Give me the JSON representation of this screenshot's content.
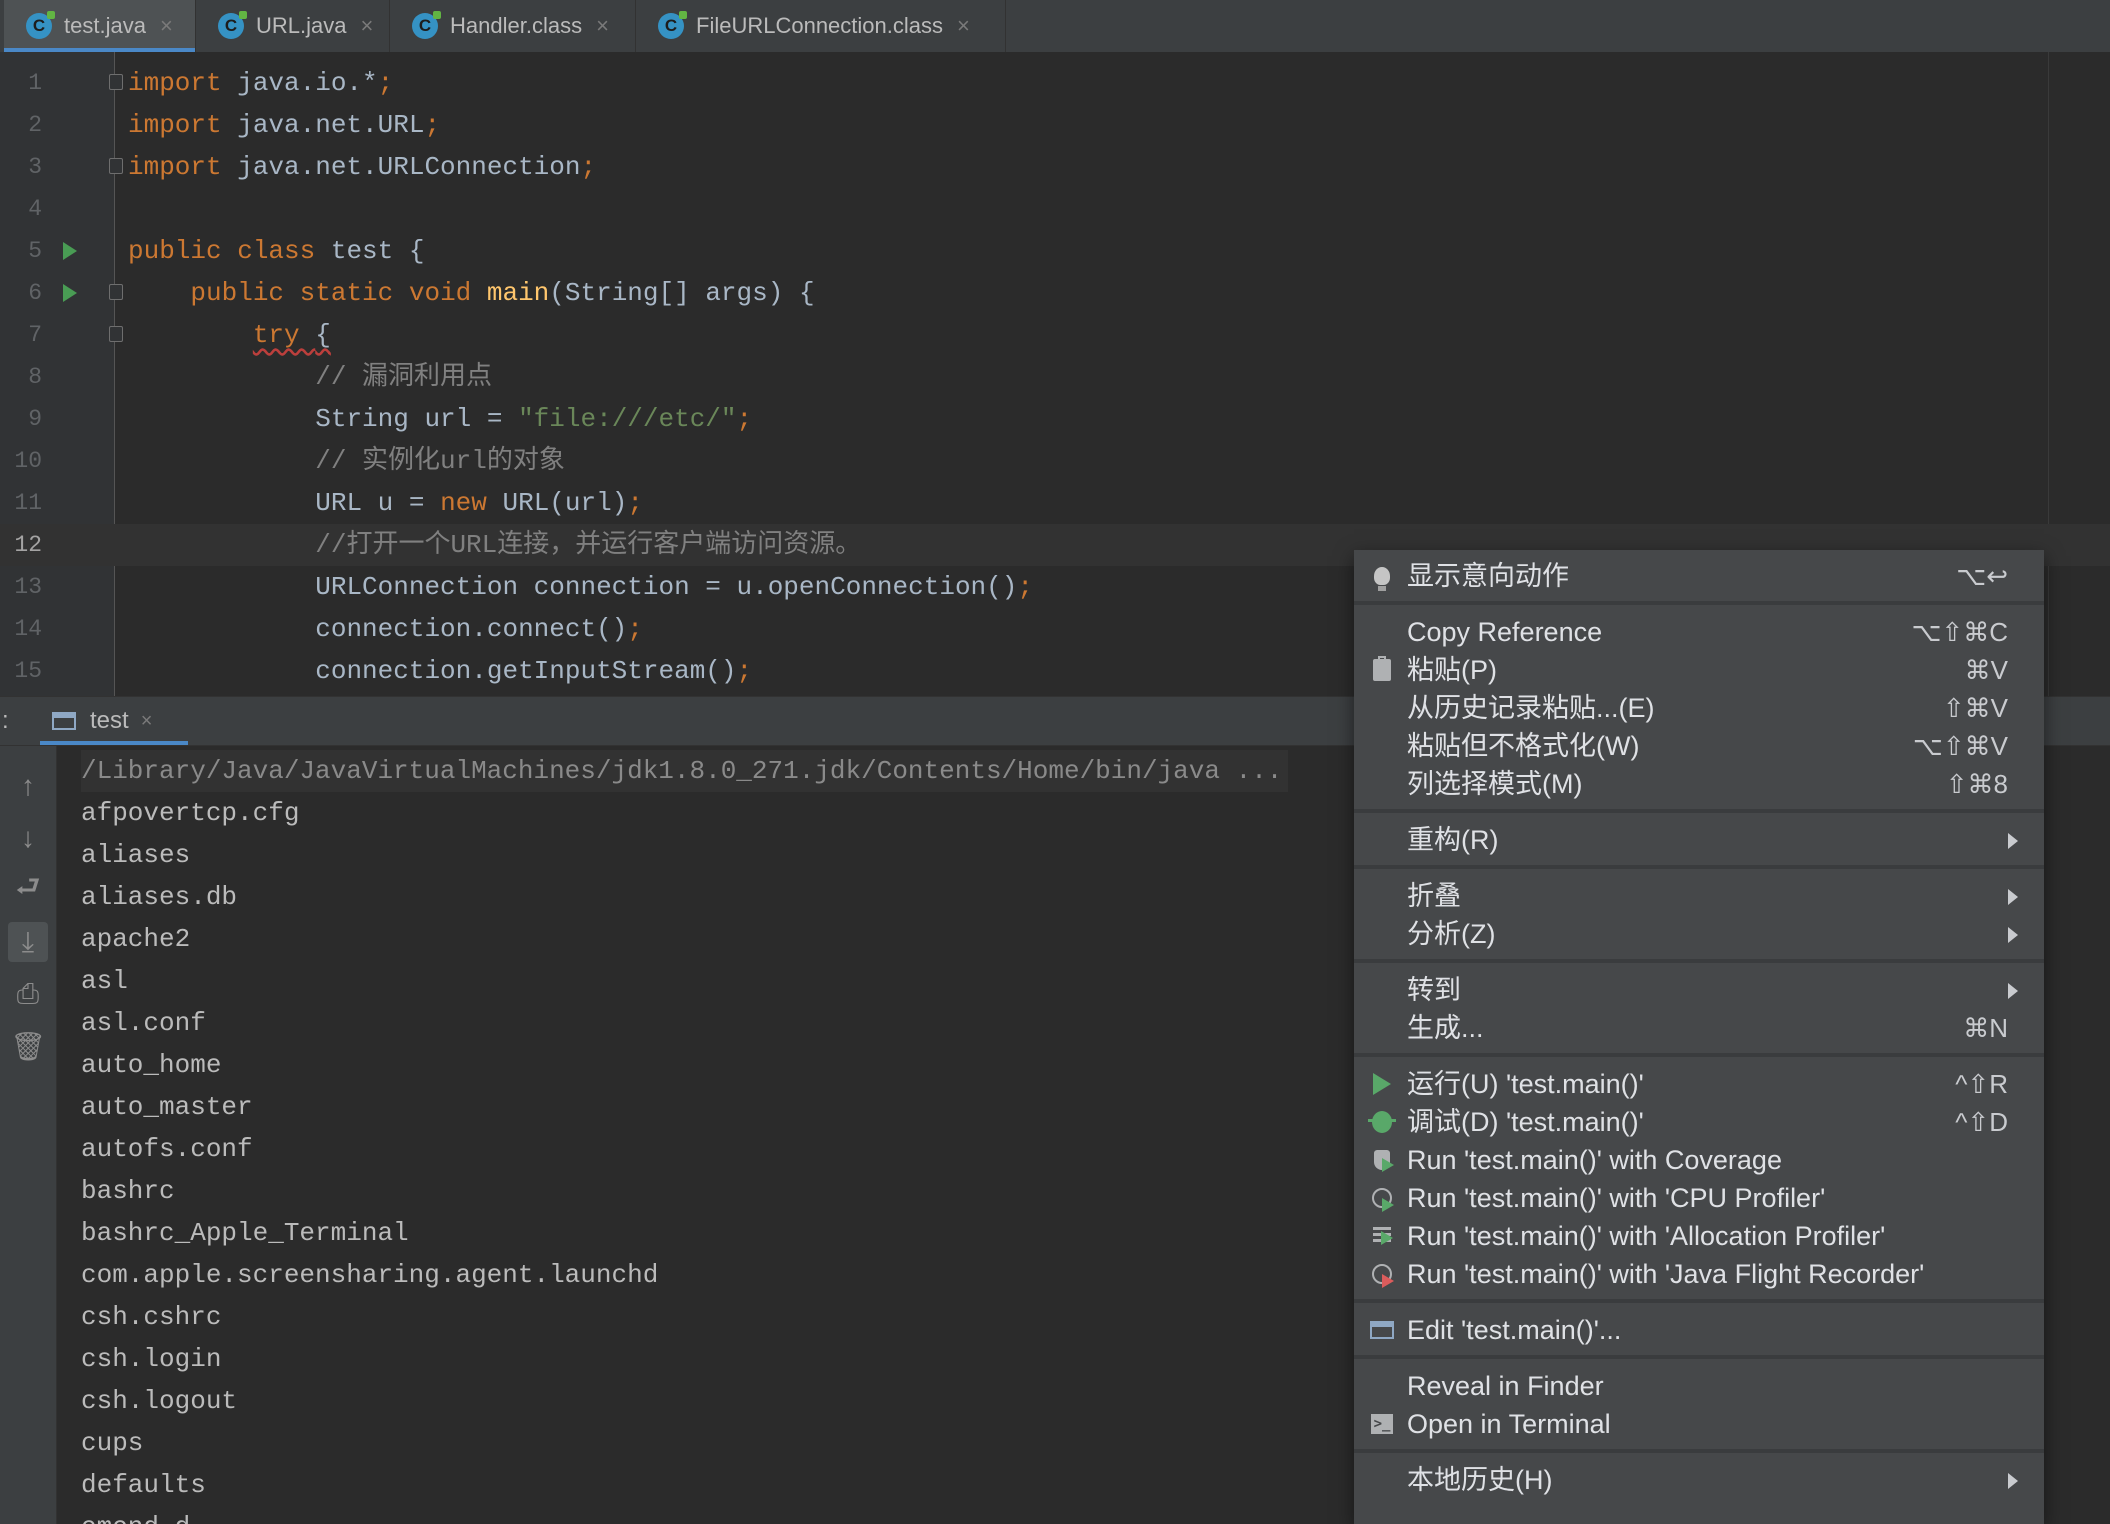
{
  "tabs": [
    {
      "label": "test.java",
      "icon": "java-class-icon",
      "active": true
    },
    {
      "label": "URL.java",
      "icon": "java-class-icon",
      "active": false
    },
    {
      "label": "Handler.class",
      "icon": "java-class-icon",
      "active": false
    },
    {
      "label": "FileURLConnection.class",
      "icon": "java-class-icon",
      "active": false
    }
  ],
  "editor": {
    "current_line": 12,
    "lines": [
      {
        "n": "1",
        "tokens": [
          [
            "kw",
            "import "
          ],
          [
            "",
            "java.io.*"
          ],
          [
            "kw",
            ";"
          ]
        ]
      },
      {
        "n": "2",
        "tokens": [
          [
            "kw",
            "import "
          ],
          [
            "",
            "java.net.URL"
          ],
          [
            "kw",
            ";"
          ]
        ]
      },
      {
        "n": "3",
        "tokens": [
          [
            "kw",
            "import "
          ],
          [
            "",
            "java.net.URLConnection"
          ],
          [
            "kw",
            ";"
          ]
        ]
      },
      {
        "n": "4",
        "tokens": []
      },
      {
        "n": "5",
        "tokens": [
          [
            "kw",
            "public class "
          ],
          [
            "",
            "test {"
          ]
        ]
      },
      {
        "n": "6",
        "tokens": [
          [
            "",
            "    "
          ],
          [
            "kw",
            "public static void "
          ],
          [
            "fn",
            "main"
          ],
          [
            "",
            "(String[] args) {"
          ]
        ]
      },
      {
        "n": "7",
        "tokens": [
          [
            "",
            "        "
          ],
          [
            "kw wavy",
            "try "
          ],
          [
            "wavy",
            "{"
          ]
        ]
      },
      {
        "n": "8",
        "tokens": [
          [
            "",
            "            "
          ],
          [
            "cmt",
            "// 漏洞利用点"
          ]
        ]
      },
      {
        "n": "9",
        "tokens": [
          [
            "",
            "            "
          ],
          [
            "",
            "String url = "
          ],
          [
            "str",
            "\"file:///etc/\""
          ],
          [
            "kw",
            ";"
          ]
        ]
      },
      {
        "n": "10",
        "tokens": [
          [
            "",
            "            "
          ],
          [
            "cmt",
            "// 实例化url的对象"
          ]
        ]
      },
      {
        "n": "11",
        "tokens": [
          [
            "",
            "            "
          ],
          [
            "",
            "URL u = "
          ],
          [
            "kw",
            "new "
          ],
          [
            "",
            "URL(url)"
          ],
          [
            "kw",
            ";"
          ]
        ]
      },
      {
        "n": "12",
        "tokens": [
          [
            "",
            "            "
          ],
          [
            "cmt",
            "//打开一个URL连接，并运行客户端访问资源。"
          ]
        ]
      },
      {
        "n": "13",
        "tokens": [
          [
            "",
            "            "
          ],
          [
            "",
            "URLConnection connection = u.openConnection()"
          ],
          [
            "kw",
            ";"
          ]
        ]
      },
      {
        "n": "14",
        "tokens": [
          [
            "",
            "            "
          ],
          [
            "",
            "connection.connect()"
          ],
          [
            "kw",
            ";"
          ]
        ]
      },
      {
        "n": "15",
        "tokens": [
          [
            "",
            "            "
          ],
          [
            "",
            "connection.getInputStream()"
          ],
          [
            "kw",
            ";"
          ]
        ]
      }
    ]
  },
  "run_panel": {
    "prefix": ":",
    "tab_label": "test",
    "tools": [
      "up-arrow-icon",
      "down-arrow-icon",
      "soft-wrap-icon",
      "scroll-to-end-icon",
      "print-icon",
      "trash-icon"
    ],
    "output": [
      "/Library/Java/JavaVirtualMachines/jdk1.8.0_271.jdk/Contents/Home/bin/java ...",
      "afpovertcp.cfg",
      "aliases",
      "aliases.db",
      "apache2",
      "asl",
      "asl.conf",
      "auto_home",
      "auto_master",
      "autofs.conf",
      "bashrc",
      "bashrc_Apple_Terminal",
      "com.apple.screensharing.agent.launchd",
      "csh.cshrc",
      "csh.login",
      "csh.logout",
      "cups",
      "defaults",
      "emond.d"
    ]
  },
  "context_menu": {
    "groups": [
      [
        {
          "label": "显示意向动作",
          "shortcut": "⌥↩",
          "icon": "bulb-icon"
        }
      ],
      [
        {
          "label": "Copy Reference",
          "shortcut": "⌥⇧⌘C"
        },
        {
          "label": "粘贴(P)",
          "shortcut": "⌘V",
          "icon": "clipboard-icon"
        },
        {
          "label": "从历史记录粘贴...(E)",
          "shortcut": "⇧⌘V"
        },
        {
          "label": "粘贴但不格式化(W)",
          "shortcut": "⌥⇧⌘V"
        },
        {
          "label": "列选择模式(M)",
          "shortcut": "⇧⌘8"
        }
      ],
      [
        {
          "label": "重构(R)",
          "submenu": true
        }
      ],
      [
        {
          "label": "折叠",
          "submenu": true
        },
        {
          "label": "分析(Z)",
          "submenu": true
        }
      ],
      [
        {
          "label": "转到",
          "submenu": true
        },
        {
          "label": "生成...",
          "shortcut": "⌘N"
        }
      ],
      [
        {
          "label": "运行(U) 'test.main()'",
          "shortcut": "^⇧R",
          "icon": "run-icon"
        },
        {
          "label": "调试(D) 'test.main()'",
          "shortcut": "^⇧D",
          "icon": "debug-icon"
        },
        {
          "label": "Run 'test.main()' with Coverage",
          "icon": "coverage-icon"
        },
        {
          "label": "Run 'test.main()' with 'CPU Profiler'",
          "icon": "cpu-profiler-icon"
        },
        {
          "label": "Run 'test.main()' with 'Allocation Profiler'",
          "icon": "allocation-profiler-icon"
        },
        {
          "label": "Run 'test.main()' with 'Java Flight Recorder'",
          "icon": "flight-recorder-icon"
        }
      ],
      [
        {
          "label": "Edit 'test.main()'...",
          "icon": "edit-config-icon"
        }
      ],
      [
        {
          "label": "Reveal in Finder"
        },
        {
          "label": "Open in Terminal",
          "icon": "terminal-icon"
        }
      ],
      [
        {
          "label": "本地历史(H)",
          "submenu": true
        }
      ]
    ]
  }
}
